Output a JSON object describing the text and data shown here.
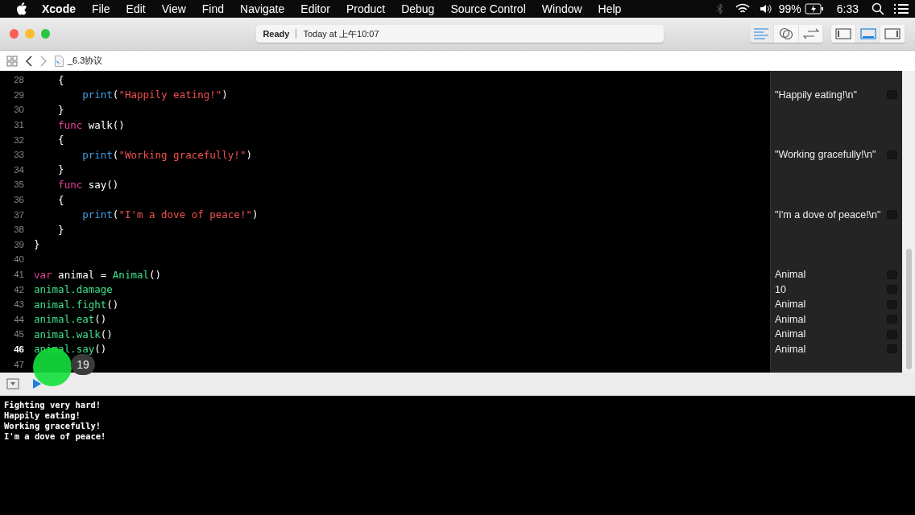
{
  "menu_bar": {
    "app": "Xcode",
    "items": [
      "File",
      "Edit",
      "View",
      "Find",
      "Navigate",
      "Editor",
      "Product",
      "Debug",
      "Source Control",
      "Window",
      "Help"
    ],
    "battery": "99%",
    "time": "6:33"
  },
  "toolbar": {
    "status": "Ready",
    "timestamp": "Today at 上午10:07",
    "editor_modes": [
      {
        "kind": "standard",
        "selected": true
      },
      {
        "kind": "assistant",
        "selected": false
      },
      {
        "kind": "version",
        "selected": false
      }
    ],
    "panels": [
      {
        "kind": "navigator",
        "selected": false
      },
      {
        "kind": "debug",
        "selected": true
      },
      {
        "kind": "utilities",
        "selected": false
      }
    ]
  },
  "jump_bar": {
    "file": "_6.3协议"
  },
  "editor": {
    "lines": [
      {
        "number": "28",
        "current": false,
        "tokens": [
          {
            "kind": "plain",
            "text": "    {"
          }
        ]
      },
      {
        "number": "29",
        "current": false,
        "tokens": [
          {
            "kind": "call",
            "text": "        print"
          },
          {
            "kind": "plain",
            "text": "("
          },
          {
            "kind": "string",
            "text": "\"Happily eating!\""
          },
          {
            "kind": "plain",
            "text": ")"
          }
        ],
        "result": "\"Happily eating!\\n\""
      },
      {
        "number": "30",
        "current": false,
        "tokens": [
          {
            "kind": "plain",
            "text": "    }"
          }
        ]
      },
      {
        "number": "31",
        "current": false,
        "tokens": [
          {
            "kind": "keyword",
            "text": "    func"
          },
          {
            "kind": "plain",
            "text": " walk()"
          }
        ]
      },
      {
        "number": "32",
        "current": false,
        "tokens": [
          {
            "kind": "plain",
            "text": "    {"
          }
        ]
      },
      {
        "number": "33",
        "current": false,
        "tokens": [
          {
            "kind": "call",
            "text": "        print"
          },
          {
            "kind": "plain",
            "text": "("
          },
          {
            "kind": "string",
            "text": "\"Working gracefully!\""
          },
          {
            "kind": "plain",
            "text": ")"
          }
        ],
        "result": "\"Working gracefully!\\n\""
      },
      {
        "number": "34",
        "current": false,
        "tokens": [
          {
            "kind": "plain",
            "text": "    }"
          }
        ]
      },
      {
        "number": "35",
        "current": false,
        "tokens": [
          {
            "kind": "keyword",
            "text": "    func"
          },
          {
            "kind": "plain",
            "text": " say()"
          }
        ]
      },
      {
        "number": "36",
        "current": false,
        "tokens": [
          {
            "kind": "plain",
            "text": "    {"
          }
        ]
      },
      {
        "number": "37",
        "current": false,
        "tokens": [
          {
            "kind": "call",
            "text": "        print"
          },
          {
            "kind": "plain",
            "text": "("
          },
          {
            "kind": "string",
            "text": "\"I'm a dove of peace!\""
          },
          {
            "kind": "plain",
            "text": ")"
          }
        ],
        "result": "\"I'm a dove of peace!\\n\""
      },
      {
        "number": "38",
        "current": false,
        "tokens": [
          {
            "kind": "plain",
            "text": "    }"
          }
        ]
      },
      {
        "number": "39",
        "current": false,
        "tokens": [
          {
            "kind": "plain",
            "text": "}"
          }
        ]
      },
      {
        "number": "40",
        "current": false
      },
      {
        "number": "41",
        "current": false,
        "tokens": [
          {
            "kind": "keyword",
            "text": "var"
          },
          {
            "kind": "plain",
            "text": " animal = "
          },
          {
            "kind": "type",
            "text": "Animal"
          },
          {
            "kind": "plain",
            "text": "()"
          }
        ],
        "result": "Animal"
      },
      {
        "number": "42",
        "current": false,
        "tokens": [
          {
            "kind": "type",
            "text": "animal.damage"
          }
        ],
        "result": "10"
      },
      {
        "number": "43",
        "current": false,
        "tokens": [
          {
            "kind": "type",
            "text": "animal.fight"
          },
          {
            "kind": "plain",
            "text": "()"
          }
        ],
        "result": "Animal"
      },
      {
        "number": "44",
        "current": false,
        "tokens": [
          {
            "kind": "type",
            "text": "animal.eat"
          },
          {
            "kind": "plain",
            "text": "()"
          }
        ],
        "result": "Animal"
      },
      {
        "number": "45",
        "current": false,
        "tokens": [
          {
            "kind": "type",
            "text": "animal.walk"
          },
          {
            "kind": "plain",
            "text": "()"
          }
        ],
        "result": "Animal"
      },
      {
        "number": "46",
        "current": true,
        "tokens": [
          {
            "kind": "type",
            "text": "animal.say"
          },
          {
            "kind": "plain",
            "text": "()"
          }
        ],
        "result": "Animal"
      },
      {
        "number": "47",
        "current": false
      }
    ],
    "click_badge": "19"
  },
  "console": {
    "lines": [
      "Fighting very hard!",
      "Happily eating!",
      "Working gracefully!",
      "I'm a dove of peace!"
    ]
  }
}
